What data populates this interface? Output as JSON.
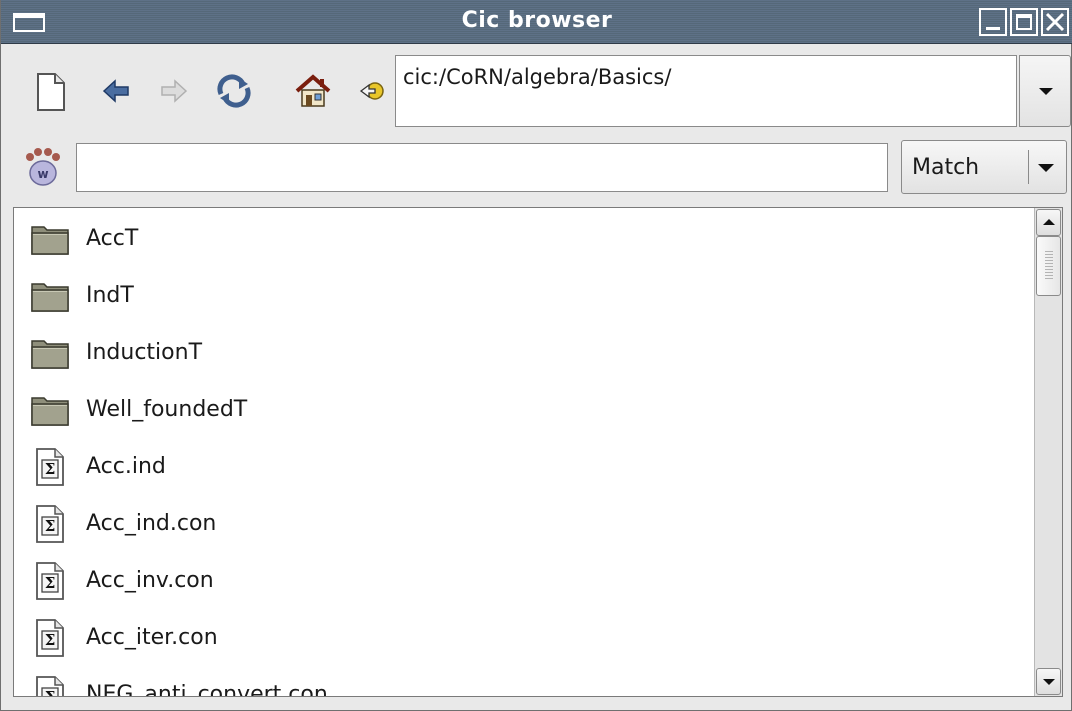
{
  "window": {
    "title": "Cic browser"
  },
  "toolbar": {
    "icons": [
      "new-page-icon",
      "back-arrow-icon",
      "forward-arrow-icon",
      "refresh-icon",
      "home-icon",
      "go-icon"
    ],
    "url_value": "cic:/CoRN/algebra/Basics/"
  },
  "search": {
    "icon": "whelp-paw-icon",
    "value": "",
    "mode_label": "Match"
  },
  "list": {
    "items": [
      {
        "label": "AccT",
        "icon": "folder-icon"
      },
      {
        "label": "IndT",
        "icon": "folder-icon"
      },
      {
        "label": "InductionT",
        "icon": "folder-icon"
      },
      {
        "label": "Well_foundedT",
        "icon": "folder-icon"
      },
      {
        "label": "Acc.ind",
        "icon": "sigma-document-icon"
      },
      {
        "label": "Acc_ind.con",
        "icon": "sigma-document-icon"
      },
      {
        "label": "Acc_inv.con",
        "icon": "sigma-document-icon"
      },
      {
        "label": "Acc_iter.con",
        "icon": "sigma-document-icon"
      },
      {
        "label": "NEG_anti_convert.con",
        "icon": "sigma-document-icon"
      }
    ]
  },
  "colors": {
    "titlebar": "#5a6c80",
    "window_bg": "#e9e9e9",
    "folder": "#8c8c78"
  }
}
